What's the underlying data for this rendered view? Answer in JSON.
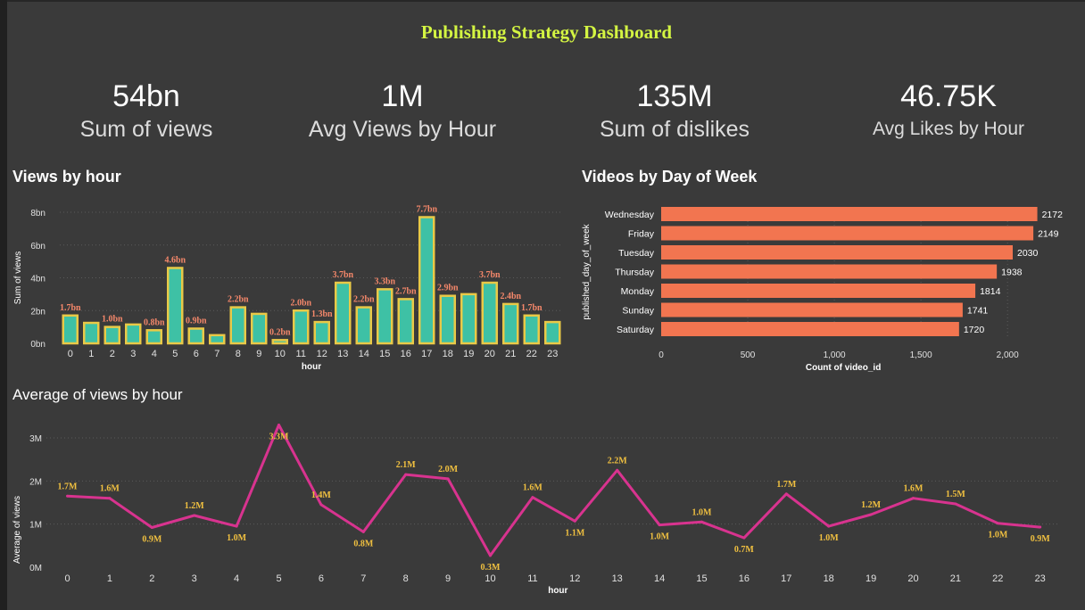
{
  "dashboard": {
    "title": "Publishing Strategy Dashboard",
    "kpis": [
      {
        "value": "54bn",
        "label": "Sum of views"
      },
      {
        "value": "1M",
        "label": "Avg Views by Hour"
      },
      {
        "value": "135M",
        "label": "Sum of dislikes"
      },
      {
        "value": "46.75K",
        "label": "Avg Likes by Hour"
      }
    ]
  },
  "chart_data": [
    {
      "type": "bar",
      "title": "Views by hour",
      "xlabel": "hour",
      "ylabel": "Sum of views",
      "ylim": [
        0,
        8
      ],
      "y_unit": "bn",
      "y_ticks": [
        "0bn",
        "2bn",
        "4bn",
        "6bn",
        "8bn"
      ],
      "categories": [
        "0",
        "1",
        "2",
        "3",
        "4",
        "5",
        "6",
        "7",
        "8",
        "9",
        "10",
        "11",
        "12",
        "13",
        "14",
        "15",
        "16",
        "17",
        "18",
        "19",
        "20",
        "21",
        "22",
        "23"
      ],
      "values": [
        1.7,
        1.25,
        1.0,
        1.15,
        0.8,
        4.6,
        0.9,
        0.5,
        2.2,
        1.8,
        0.2,
        2.0,
        1.3,
        3.7,
        2.2,
        3.3,
        2.7,
        7.7,
        2.9,
        3.0,
        3.7,
        2.4,
        1.7,
        1.3
      ],
      "data_labels": [
        "1.7bn",
        "",
        "1.0bn",
        "",
        "0.8bn",
        "4.6bn",
        "0.9bn",
        "",
        "2.2bn",
        "",
        "0.2bn",
        "2.0bn",
        "1.3bn",
        "3.7bn",
        "2.2bn",
        "3.3bn",
        "2.7bn",
        "7.7bn",
        "2.9bn",
        "",
        "3.7bn",
        "2.4bn",
        "1.7bn",
        ""
      ],
      "colors": {
        "bar": "#3ec1a5",
        "border": "#e9c947",
        "label": "#f4876a"
      },
      "grid": true
    },
    {
      "type": "bar",
      "orientation": "horizontal",
      "title": "Videos by Day of Week",
      "xlabel": "Count of video_id",
      "ylabel": "published_day_of_week",
      "xlim": [
        0,
        2200
      ],
      "x_ticks": [
        "0",
        "500",
        "1,000",
        "1,500",
        "2,000"
      ],
      "categories": [
        "Wednesday",
        "Friday",
        "Tuesday",
        "Thursday",
        "Monday",
        "Sunday",
        "Saturday"
      ],
      "values": [
        2172,
        2149,
        2030,
        1938,
        1814,
        1741,
        1720
      ],
      "data_labels": [
        "2172",
        "2149",
        "2030",
        "1938",
        "1814",
        "1741",
        "1720"
      ],
      "colors": {
        "bar": "#f27550"
      },
      "grid": true
    },
    {
      "type": "line",
      "title": "Average of views by hour",
      "xlabel": "hour",
      "ylabel": "Average of views",
      "ylim": [
        0,
        3
      ],
      "y_unit": "M",
      "y_ticks": [
        "0M",
        "1M",
        "2M",
        "3M"
      ],
      "categories": [
        "0",
        "1",
        "2",
        "3",
        "4",
        "5",
        "6",
        "7",
        "8",
        "9",
        "10",
        "11",
        "12",
        "13",
        "14",
        "15",
        "16",
        "17",
        "18",
        "19",
        "20",
        "21",
        "22",
        "23"
      ],
      "values": [
        1.65,
        1.6,
        0.92,
        1.2,
        0.95,
        3.3,
        1.45,
        0.82,
        2.15,
        2.05,
        0.27,
        1.62,
        1.07,
        2.25,
        0.98,
        1.05,
        0.68,
        1.7,
        0.95,
        1.22,
        1.6,
        1.47,
        1.02,
        0.93
      ],
      "data_labels": [
        "1.7M",
        "1.6M",
        "0.9M",
        "1.2M",
        "1.0M",
        "3.3M",
        "1.4M",
        "0.8M",
        "2.1M",
        "2.0M",
        "0.3M",
        "1.6M",
        "1.1M",
        "2.2M",
        "1.0M",
        "1.0M",
        "0.7M",
        "1.7M",
        "1.0M",
        "1.2M",
        "1.6M",
        "1.5M",
        "1.0M",
        "0.9M"
      ],
      "label_positions": [
        "above",
        "above",
        "below",
        "above",
        "below",
        "below",
        "above",
        "below",
        "above",
        "above",
        "below",
        "above",
        "below",
        "above",
        "below",
        "above",
        "below",
        "above",
        "below",
        "above",
        "above",
        "above",
        "below",
        "below"
      ],
      "colors": {
        "line": "#d8338f",
        "label": "#f0c040"
      },
      "grid": true
    }
  ]
}
